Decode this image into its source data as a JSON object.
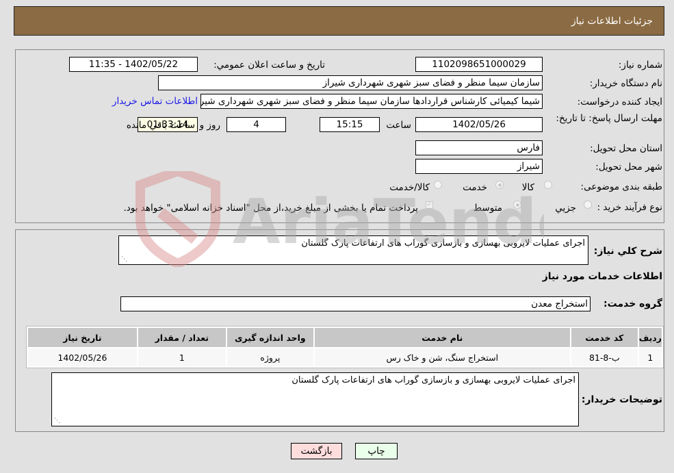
{
  "header": {
    "title": "جزئیات اطلاعات نیاز"
  },
  "form": {
    "need_number": {
      "label": "شماره نیاز:",
      "value": "1102098651000029"
    },
    "announce": {
      "label": "تاریخ و ساعت اعلان عمومي:",
      "value": "1402/05/22 - 11:35"
    },
    "buyer_org": {
      "label": "نام دستگاه خریدار:",
      "value": "سازمان سیما منظر و فضای سبز شهری شهرداری شیراز"
    },
    "requester": {
      "label": "ایجاد کننده درخواست:",
      "value": "شیما کیمیائی کارشناس قراردادها سازمان سیما منظر و فضای سبز شهری شهرداری شیراز",
      "contact_link": "اطلاعات تماس خریدار"
    },
    "deadline": {
      "label": "مهلت ارسال پاسخ: تا تاریخ:",
      "date": "1402/05/26",
      "time_label": "ساعت",
      "time": "15:15",
      "days": "4",
      "days_label": "روز و",
      "remaining": "01:33:14",
      "remaining_label": "ساعت باقي مانده"
    },
    "province": {
      "label": "استان محل تحویل:",
      "value": "فارس"
    },
    "city": {
      "label": "شهر محل تحویل:",
      "value": "شیراز"
    },
    "category": {
      "label": "طبقه بندی موضوعی:",
      "options": [
        "کالا",
        "خدمت",
        "کالا/خدمت"
      ],
      "selected": "خدمت"
    },
    "process": {
      "label": "نوع فرآیند خرید :",
      "options": [
        "جزيي",
        "متوسط"
      ],
      "selected": "متوسط",
      "treasury_note": "پرداخت تمام یا بخشی از مبلغ خرید،از محل \"اسناد خزانه اسلامی\" خواهد بود.",
      "treasury_checked": true
    }
  },
  "details": {
    "summary_label": "شرح کلي نیاز:",
    "summary_value": "اجرای عملیات لایروبی بهسازی و بازسازی گوراب های ارتفاعات پارک گلستان",
    "services_heading": "اطلاعات خدمات مورد نیاز",
    "service_group_label": "گروه خدمت:",
    "service_group_value": "استخراج معدن",
    "table": {
      "headers": [
        "ردیف",
        "کد خدمت",
        "نام خدمت",
        "واحد اندازه گیری",
        "تعداد / مقدار",
        "تاریخ نیاز"
      ],
      "rows": [
        [
          "1",
          "ب-8-81",
          "استخراج سنگ، شن و خاک رس",
          "پروژه",
          "1",
          "1402/05/26"
        ]
      ]
    },
    "buyer_notes_label": "توضیحات خریدار:",
    "buyer_notes_value": "اجرای عملیات لایروبی بهسازی و بازسازی گوراب های ارتفاعات پارک گلستان"
  },
  "buttons": {
    "print": "چاپ",
    "back": "بازگشت"
  },
  "watermark": {
    "text": "AriaTender.net"
  },
  "colors": {
    "header": "#8b6b43",
    "link": "#1c19e8",
    "print_bg": "#eaffea",
    "back_bg": "#ffdddd",
    "remaining_bg": "#ffffe6"
  }
}
